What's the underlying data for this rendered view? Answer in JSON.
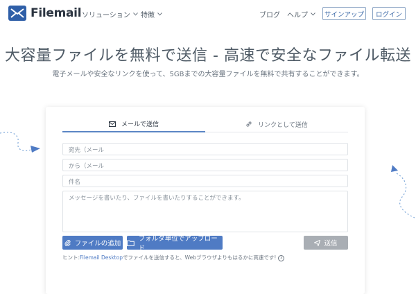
{
  "header": {
    "logo_text": "Filemail",
    "nav": [
      {
        "label": "ソリューション"
      },
      {
        "label": "特徴"
      }
    ],
    "right_nav": [
      {
        "label": "ブログ"
      },
      {
        "label": "ヘルプ"
      }
    ],
    "signup_label": "サインアップ",
    "login_label": "ログイン"
  },
  "hero": {
    "title": "大容量ファイルを無料で送信 - 高速で安全なファイル転送",
    "subtitle": "電子メールや安全なリンクを使って、5GBまでの大容量ファイルを無料で共有することができます。"
  },
  "form": {
    "tabs": [
      {
        "label": "メールで送信",
        "icon": "envelope-icon",
        "active": true
      },
      {
        "label": "リンクとして送信",
        "icon": "link-icon",
        "active": false
      }
    ],
    "to_placeholder": "宛先（メール",
    "from_placeholder": "から（メール",
    "subject_placeholder": "件名",
    "message_placeholder": "メッセージを書いたり、ファイルを書いたりすることができます。",
    "add_files_label": "ファイルの追加",
    "upload_folder_label": "フォルダ単位でアップロード",
    "send_label": "送信",
    "hint_prefix": "ヒント:",
    "hint_link": "Filemail Desktop",
    "hint_suffix": "でファイルを送信すると、Webブラウザよりもはるかに高速です!"
  },
  "colors": {
    "accent": "#4f7bc4",
    "logo": "#2f5fa8",
    "send_disabled": "#a9aeb4"
  }
}
